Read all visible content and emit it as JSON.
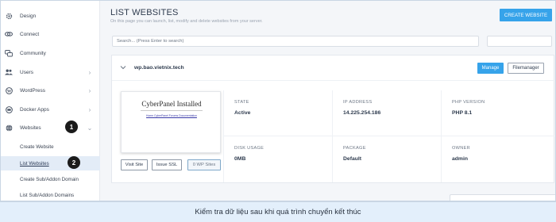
{
  "sidebar": {
    "items": [
      {
        "label": "Design",
        "icon": "gear-icon",
        "has_chevron": false
      },
      {
        "label": "Connect",
        "icon": "link-icon",
        "has_chevron": false
      },
      {
        "label": "Community",
        "icon": "chat-icon",
        "has_chevron": false
      },
      {
        "label": "Users",
        "icon": "users-icon",
        "has_chevron": true
      },
      {
        "label": "WordPress",
        "icon": "wordpress-icon",
        "has_chevron": true
      },
      {
        "label": "Docker Apps",
        "icon": "docker-icon",
        "has_chevron": true
      },
      {
        "label": "Websites",
        "icon": "globe-icon",
        "has_chevron": true,
        "expanded": true
      }
    ],
    "sub_items": [
      {
        "label": "Create Website"
      },
      {
        "label": "List Websites",
        "active": true
      },
      {
        "label": "Create Sub/Addon Domain"
      },
      {
        "label": "List Sub/Addon Domains"
      }
    ],
    "markers": [
      "1",
      "2"
    ]
  },
  "header": {
    "title": "LIST WEBSITES",
    "subtitle": "On this page you can launch, list, modify and delete websites from your server.",
    "create_button": "CREATE WEBSITE"
  },
  "search": {
    "placeholder": "Search... (Press Enter to search)"
  },
  "website": {
    "domain": "wp.bao.vietnix.tech",
    "manage_button": "Manage",
    "filemanager_button": "Filemanager",
    "preview": {
      "title": "CyberPanel Installed",
      "link_text": "Home CyberPanel Forums Documentation"
    },
    "actions": {
      "visit_site": "Visit Site",
      "issue_ssl": "Issue SSL",
      "wp_sites": "0 WP Sites"
    },
    "info": [
      {
        "label": "STATE",
        "value": "Active"
      },
      {
        "label": "IP ADDRESS",
        "value": "14.225.254.186"
      },
      {
        "label": "PHP VERSION",
        "value": "PHP 8.1"
      },
      {
        "label": "DISK USAGE",
        "value": "0MB"
      },
      {
        "label": "PACKAGE",
        "value": "Default"
      },
      {
        "label": "OWNER",
        "value": "admin"
      }
    ]
  },
  "caption": "Kiểm tra dữ liệu sau khi quá trình chuyển kết thúc",
  "colors": {
    "accent": "#36a3ea",
    "active_sub_bg": "#e3ecf7",
    "caption_bg": "#e3effb"
  }
}
